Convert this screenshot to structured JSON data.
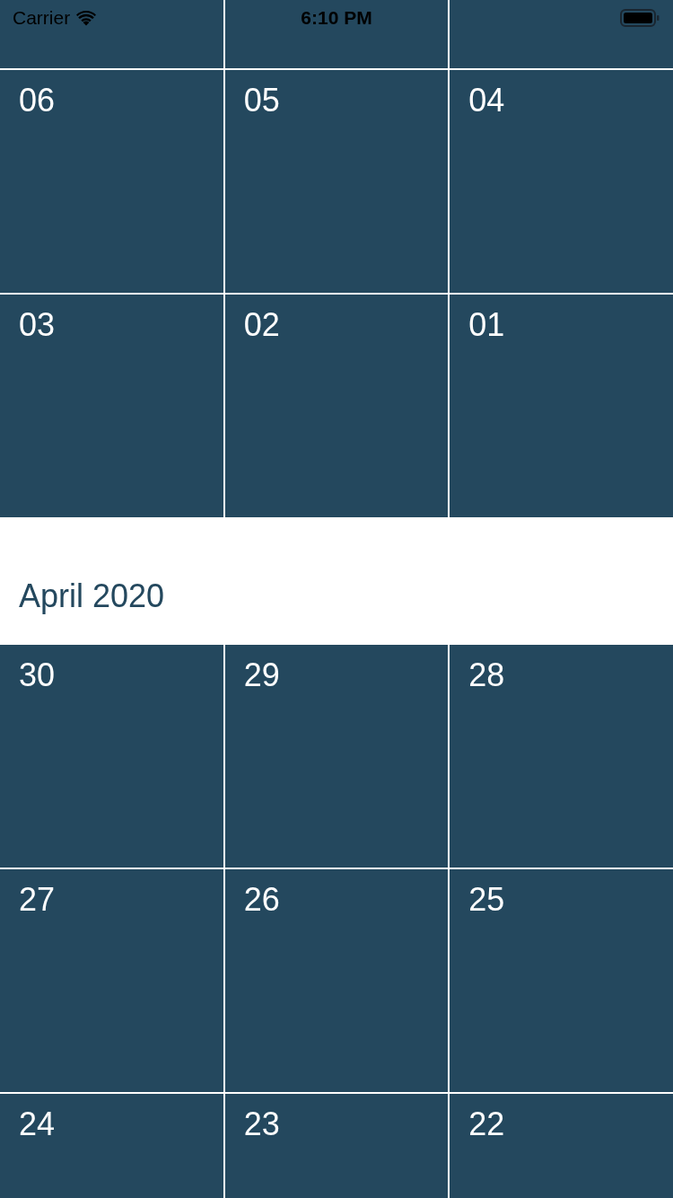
{
  "status_bar": {
    "carrier": "Carrier",
    "time": "6:10 PM"
  },
  "sections": [
    {
      "clipped_row_above": true,
      "rows": [
        [
          "06",
          "05",
          "04"
        ],
        [
          "03",
          "02",
          "01"
        ]
      ]
    },
    {
      "title": "April 2020",
      "rows": [
        [
          "30",
          "29",
          "28"
        ],
        [
          "27",
          "26",
          "25"
        ],
        [
          "24",
          "23",
          "22"
        ]
      ]
    }
  ]
}
